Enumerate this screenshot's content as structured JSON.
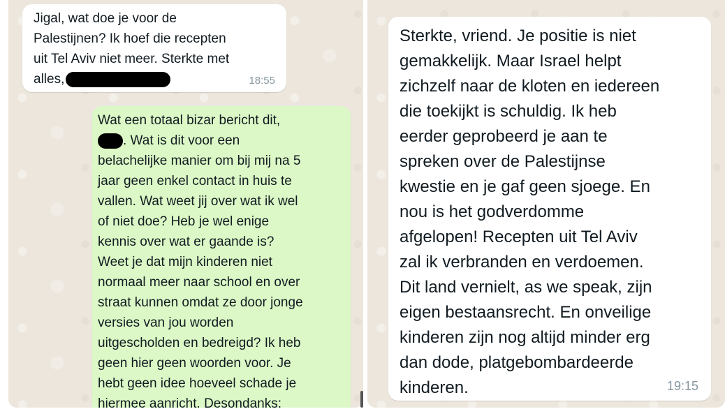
{
  "left_chat": {
    "incoming_message": {
      "text_lines": [
        "Jigal, wat doe je voor de",
        "Palestijnen? Ik hoef die recepten",
        "uit Tel Aviv niet meer. Sterkte met",
        "alles,"
      ],
      "time": "18:55"
    },
    "outgoing_message": {
      "text_lines": [
        "Wat een totaal bizar bericht dit,",
        ". Wat is dit voor een",
        "belachelijke manier om bij mij na 5",
        "jaar geen enkel contact in huis te",
        "vallen. Wat weet jij over wat ik wel",
        "of niet doe? Heb je wel enige",
        "kennis over wat er gaande is?",
        "Weet je dat mijn kinderen niet",
        "normaal meer naar school en over",
        "straat kunnen omdat ze door jonge",
        "versies van jou worden",
        "uitgescholden en bedreigd? Ik heb",
        "geen hier geen woorden voor. Je",
        "hebt geen idee hoeveel schade je",
        "hiermee aanricht. Desondanks:"
      ]
    }
  },
  "right_chat": {
    "incoming_message": {
      "text_lines": [
        "Sterkte, vriend. Je positie is niet",
        "gemakkelijk. Maar Israel helpt",
        "zichzelf naar de kloten en iedereen",
        "die toekijkt is schuldig. Ik heb",
        "eerder geprobeerd je aan te",
        "spreken over de Palestijnse",
        "kwestie en je gaf geen sjoege. En",
        "nou is het godverdomme",
        "afgelopen! Recepten uit Tel Aviv",
        "zal ik verbranden en verdoemen.",
        "Dit land vernielt, as we speak, zijn",
        "eigen bestaansrecht. En onveilige",
        "kinderen zijn nog altijd minder erg",
        "dan dode, platgebombardeerde",
        "kinderen."
      ],
      "time": "19:15"
    }
  },
  "colors": {
    "chat_background": "#ece6dd",
    "incoming_bubble": "#ffffff",
    "outgoing_bubble": "#dcf8c6",
    "timestamp": "#8696a0"
  }
}
